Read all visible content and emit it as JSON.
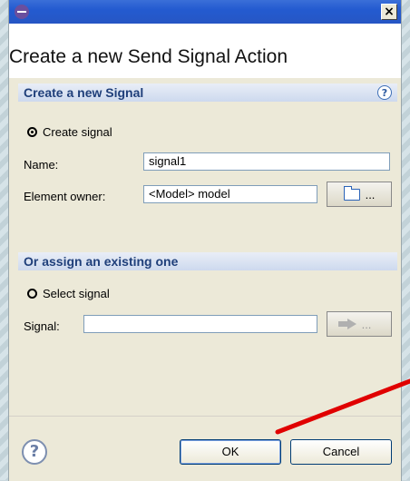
{
  "dialog": {
    "title": "Create a new Send Signal Action",
    "close_glyph": "×"
  },
  "new_signal_section": {
    "heading": "Create a new Signal",
    "help_glyph": "?",
    "radio_label": "Create signal",
    "radio_selected": true,
    "name_label": "Name:",
    "name_value": "signal1",
    "owner_label": "Element owner:",
    "owner_value": "<Model> model",
    "browse_label": "..."
  },
  "existing_section": {
    "heading": "Or assign an existing one",
    "radio_label": "Select signal",
    "radio_selected": false,
    "signal_label": "Signal:",
    "signal_value": "",
    "browse_label": "..."
  },
  "footer": {
    "help_glyph": "?",
    "ok_label": "OK",
    "cancel_label": "Cancel"
  },
  "colors": {
    "titlebar": "#245bd0",
    "section_header_text": "#1f3f7a",
    "annotation_arrow": "#e00000"
  },
  "icons": [
    "app-icon",
    "close-icon",
    "help-icon",
    "folder-icon",
    "arrow-right-icon"
  ]
}
